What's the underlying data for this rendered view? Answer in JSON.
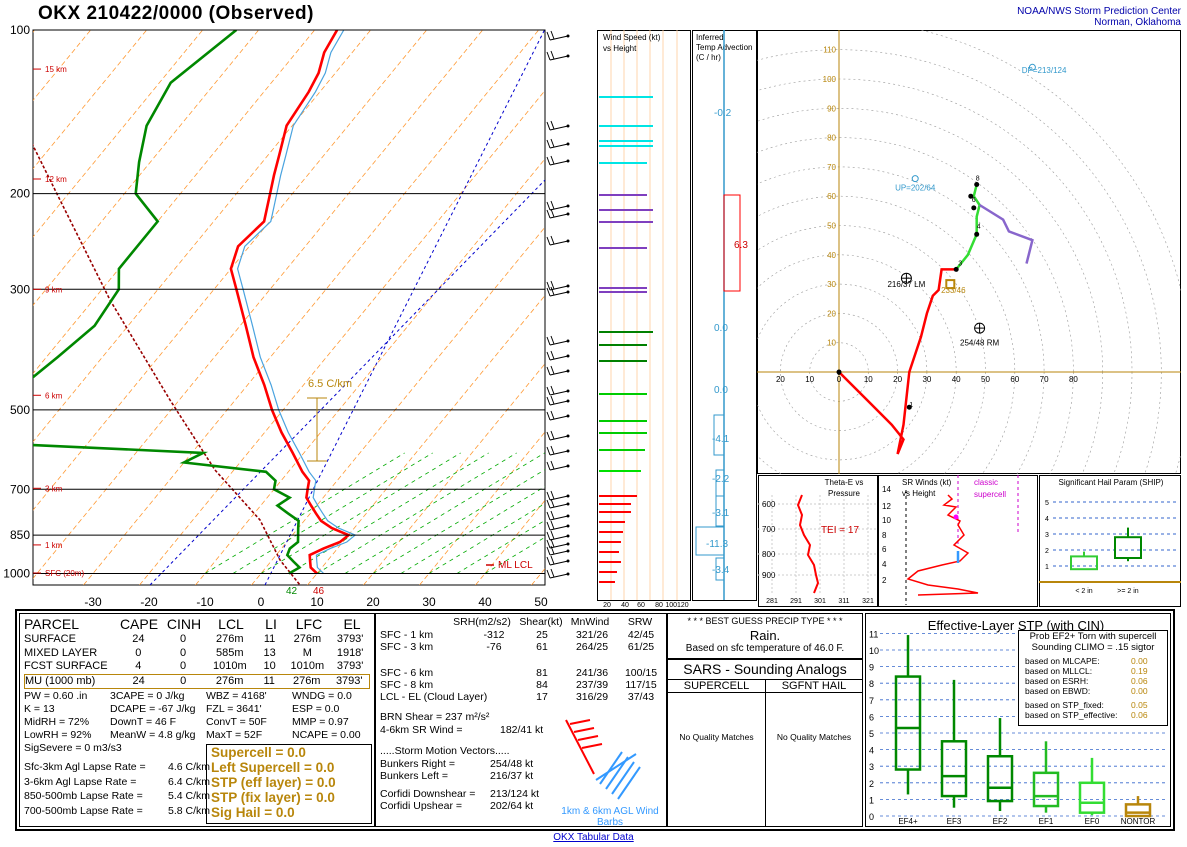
{
  "title": "OKX   210422/0000  (Observed)",
  "credit": [
    "NOAA/NWS Storm Prediction Center",
    "Norman, Oklahoma"
  ],
  "colors": {
    "temp": "#ff0000",
    "dewp": "#008800",
    "virt": "#4aa3df",
    "parcel": "#990000",
    "isotherm": "#ff9933",
    "dry": "#00aa00",
    "accent": "#b8860b"
  },
  "chart_data": [
    {
      "type": "line",
      "name": "skew-t",
      "x_ticks": [
        "-30",
        "-20",
        "-10",
        "0",
        "10",
        "20",
        "30",
        "40",
        "50"
      ],
      "x_values": [
        -30,
        -20,
        -10,
        0,
        10,
        20,
        30,
        40,
        50
      ],
      "pressure_levels": [
        100,
        200,
        300,
        500,
        700,
        850,
        1000
      ],
      "pressure_labels": [
        "100",
        "200",
        "300",
        "500",
        "700",
        "850",
        "1000"
      ],
      "height_labels": [
        {
          "p": 118,
          "t": "15 km"
        },
        {
          "p": 188,
          "t": "12 km"
        },
        {
          "p": 300,
          "t": "9 km"
        },
        {
          "p": 470,
          "t": "6 km"
        },
        {
          "p": 697,
          "t": "3 km"
        },
        {
          "p": 886,
          "t": "1 km"
        },
        {
          "p": 998,
          "t": "SFC (20m)"
        }
      ],
      "xlim": [
        -30,
        50
      ],
      "plim": [
        100,
        1050
      ],
      "temperature": [
        [
          1000,
          10
        ],
        [
          975,
          8
        ],
        [
          950,
          7
        ],
        [
          925,
          6
        ],
        [
          900,
          7.5
        ],
        [
          875,
          9.5
        ],
        [
          850,
          10
        ],
        [
          825,
          6
        ],
        [
          800,
          3
        ],
        [
          775,
          1
        ],
        [
          750,
          -1
        ],
        [
          725,
          -3
        ],
        [
          700,
          -4
        ],
        [
          675,
          -5
        ],
        [
          650,
          -7.5
        ],
        [
          600,
          -12
        ],
        [
          550,
          -17
        ],
        [
          500,
          -22
        ],
        [
          450,
          -27
        ],
        [
          400,
          -33
        ],
        [
          350,
          -39
        ],
        [
          300,
          -46
        ],
        [
          275,
          -50
        ],
        [
          250,
          -52
        ],
        [
          225,
          -51
        ],
        [
          200,
          -54
        ],
        [
          185,
          -56
        ],
        [
          170,
          -58
        ],
        [
          150,
          -61
        ],
        [
          130,
          -62
        ],
        [
          120,
          -63
        ],
        [
          110,
          -65
        ],
        [
          100,
          -66
        ]
      ],
      "dewpoint": [
        [
          1000,
          5
        ],
        [
          975,
          6
        ],
        [
          950,
          4
        ],
        [
          925,
          2
        ],
        [
          900,
          1.5
        ],
        [
          875,
          2
        ],
        [
          850,
          1
        ],
        [
          825,
          0
        ],
        [
          800,
          -1
        ],
        [
          775,
          -4
        ],
        [
          750,
          -7
        ],
        [
          725,
          -6
        ],
        [
          700,
          -10
        ],
        [
          675,
          -11
        ],
        [
          650,
          -14
        ],
        [
          625,
          -30
        ],
        [
          600,
          -28
        ],
        [
          580,
          -60
        ],
        [
          550,
          -67
        ],
        [
          500,
          -70
        ],
        [
          450,
          -70
        ],
        [
          400,
          -68
        ],
        [
          350,
          -66
        ],
        [
          300,
          -67
        ],
        [
          275,
          -70
        ],
        [
          250,
          -70
        ],
        [
          225,
          -70
        ],
        [
          200,
          -78
        ],
        [
          175,
          -82
        ],
        [
          150,
          -86
        ],
        [
          125,
          -88
        ],
        [
          100,
          -84
        ]
      ],
      "parcel_label": "ML LCL",
      "lapse_label": "6.5 C/km",
      "sfc_t": "46",
      "sfc_td": "42"
    },
    {
      "type": "bar",
      "name": "wind-speed-vs-height",
      "title": "Wind Speed (kt) vs Height",
      "x_ticks": [
        "20",
        "40",
        "60",
        "80",
        "100120"
      ]
    },
    {
      "type": "bar",
      "name": "temp-advection",
      "title": "Inferred Temp Advection (C / hr)",
      "labels": [
        "-0.2",
        "6.3",
        "0.0",
        "0.0",
        "-4.1",
        "-2.2",
        "-3.1",
        "-11.3",
        "-3.4"
      ]
    },
    {
      "type": "line",
      "name": "hodograph",
      "axis_labels": [
        "10",
        "20",
        "30",
        "40",
        "50",
        "60",
        "70",
        "80",
        "90",
        "100",
        "110"
      ],
      "x_axis_labels": [
        "20",
        "10",
        "0",
        "10",
        "20",
        "30",
        "40",
        "50",
        "60",
        "70",
        "80"
      ],
      "annotations": [
        "DP=213/124",
        "UP=202/64",
        "216/37 LM",
        "233/46",
        "254/48 RM"
      ],
      "height_marks": [
        "0",
        "1",
        "3",
        "4",
        "6",
        "8"
      ]
    },
    {
      "type": "line",
      "name": "theta-e-vs-pressure",
      "title": "Theta-E vs Pressure",
      "y_ticks": [
        "600",
        "700",
        "800",
        "900"
      ],
      "x_ticks": [
        "281",
        "291",
        "301",
        "311",
        "321"
      ],
      "annotation": "TEI = 17"
    },
    {
      "type": "line",
      "name": "sr-winds-vs-height",
      "title": "SR Winds (kt) vs Height",
      "y_ticks": [
        "14",
        "12",
        "10",
        "8",
        "6",
        "4",
        "2"
      ],
      "annotation": "classic supercell"
    },
    {
      "type": "bar",
      "name": "ship",
      "title": "Significant Hail Param (SHIP)",
      "y_ticks": [
        "1",
        "2",
        "3",
        "4",
        "5"
      ],
      "categories": [
        "< 2 in",
        ">= 2 in"
      ]
    },
    {
      "type": "bar",
      "name": "effective-stp",
      "title": "Effective-Layer STP (with CIN)",
      "categories": [
        "EF4+",
        "EF3",
        "EF2",
        "EF1",
        "EF0",
        "NONTOR"
      ],
      "y_ticks": [
        "0",
        "1",
        "2",
        "3",
        "4",
        "5",
        "6",
        "7",
        "8",
        "9",
        "10",
        "11"
      ],
      "boxes": [
        {
          "wlo": 1.3,
          "q1": 2.8,
          "med": 5.3,
          "q3": 8.4,
          "whi": 10.9
        },
        {
          "wlo": 0.5,
          "q1": 1.2,
          "med": 2.4,
          "q3": 4.5,
          "whi": 8.2
        },
        {
          "wlo": 0.3,
          "q1": 0.9,
          "med": 1.7,
          "q3": 3.6,
          "whi": 5.9
        },
        {
          "wlo": 0.2,
          "q1": 0.6,
          "med": 1.2,
          "q3": 2.6,
          "whi": 4.5
        },
        {
          "wlo": 0.05,
          "q1": 0.2,
          "med": 0.8,
          "q3": 2.0,
          "whi": 3.5
        },
        {
          "wlo": 0.0,
          "q1": 0.0,
          "med": 0.2,
          "q3": 0.7,
          "whi": 1.2
        }
      ]
    }
  ],
  "parcel": {
    "headers": [
      "PARCEL",
      "CAPE",
      "CINH",
      "LCL",
      "LI",
      "LFC",
      "EL"
    ],
    "rows": [
      [
        "SURFACE",
        "24",
        "0",
        "276m",
        "11",
        "276m",
        "3793'"
      ],
      [
        "MIXED LAYER",
        "0",
        "0",
        "585m",
        "13",
        "M",
        "1918'"
      ],
      [
        "FCST SURFACE",
        "4",
        "0",
        "1010m",
        "10",
        "1010m",
        "3793'"
      ],
      [
        "MU   (1000 mb)",
        "24",
        "0",
        "276m",
        "11",
        "276m",
        "3793'"
      ]
    ]
  },
  "indices": [
    [
      "PW = 0.60 .in",
      "3CAPE = 0 J/kg",
      "WBZ = 4168'",
      "WNDG = 0.0"
    ],
    [
      "K = 13",
      "DCAPE = -67 J/kg",
      "FZL = 3641'",
      "ESP = 0.0"
    ],
    [
      "MidRH = 72%",
      "DownT = 46 F",
      "ConvT = 50F",
      "MMP = 0.97"
    ],
    [
      "LowRH = 92%",
      "MeanW = 4.8 g/kg",
      "MaxT = 52F",
      "NCAPE = 0.00"
    ],
    [
      "SigSevere = 0 m3/s3",
      "",
      "",
      ""
    ]
  ],
  "lapse_rates": [
    [
      "Sfc-3km Agl Lapse Rate =",
      "4.6 C/km"
    ],
    [
      "3-6km Agl Lapse Rate =",
      "6.4 C/km"
    ],
    [
      "850-500mb Lapse Rate =",
      "5.4 C/km"
    ],
    [
      "700-500mb Lapse Rate =",
      "5.8 C/km"
    ]
  ],
  "severe_params": [
    "Supercell = 0.0",
    "Left Supercell = 0.0",
    "STP (eff layer) = 0.0",
    "STP (fix layer) = 0.0",
    "Sig Hail = 0.0"
  ],
  "kinematics": {
    "headers": [
      "SRH(m2/s2)",
      "Shear(kt)",
      "MnWind",
      "SRW"
    ],
    "rows": [
      [
        "SFC - 1 km",
        "-312",
        "25",
        "321/26",
        "42/45"
      ],
      [
        "SFC - 3 km",
        "-76",
        "61",
        "264/25",
        "61/25"
      ],
      [
        "",
        "",
        " ",
        "",
        ""
      ],
      [
        "SFC - 6 km",
        "",
        "81",
        "241/36",
        "100/15"
      ],
      [
        "SFC - 8 km",
        "",
        "84",
        "237/39",
        "117/15"
      ],
      [
        "LCL - EL (Cloud Layer)",
        "",
        "17",
        "316/29",
        "37/43"
      ]
    ],
    "brn": "BRN Shear =  237 m²/s²",
    "sr_wind": "4-6km SR Wind =",
    "sr_wind_val": "182/41 kt",
    "motion_title": ".....Storm Motion Vectors.....",
    "motion": [
      [
        "Bunkers Right =",
        "254/48 kt"
      ],
      [
        "Bunkers Left =",
        "216/37 kt"
      ],
      [
        "",
        ""
      ],
      [
        "Corfidi Downshear =",
        "213/124 kt"
      ],
      [
        "Corfidi Upshear =",
        "202/64 kt"
      ]
    ],
    "barb_label": "1km & 6km AGL Wind Barbs"
  },
  "precip": {
    "title": "* * * BEST GUESS PRECIP TYPE * * *",
    "type": "Rain.",
    "note": "Based on sfc temperature of 46.0 F."
  },
  "sars": {
    "title": "SARS - Sounding Analogs",
    "cols": [
      "SUPERCELL",
      "SGFNT HAIL"
    ],
    "msg": [
      "No Quality Matches",
      "No Quality Matches"
    ]
  },
  "prob": {
    "title": [
      "Prob EF2+ Torn with supercell",
      "Sounding CLIMO = .15 sigtor"
    ],
    "rows": [
      [
        "based on MLCAPE:",
        "0.00"
      ],
      [
        "based on MLLCL:",
        "0.19"
      ],
      [
        "based on ESRH:",
        "0.06"
      ],
      [
        "based on EBWD:",
        "0.00"
      ],
      [
        "based on STP_fixed:",
        "0.05"
      ],
      [
        "based on STP_effective:",
        "0.06"
      ]
    ]
  },
  "footer_link": "OKX Tabular Data"
}
